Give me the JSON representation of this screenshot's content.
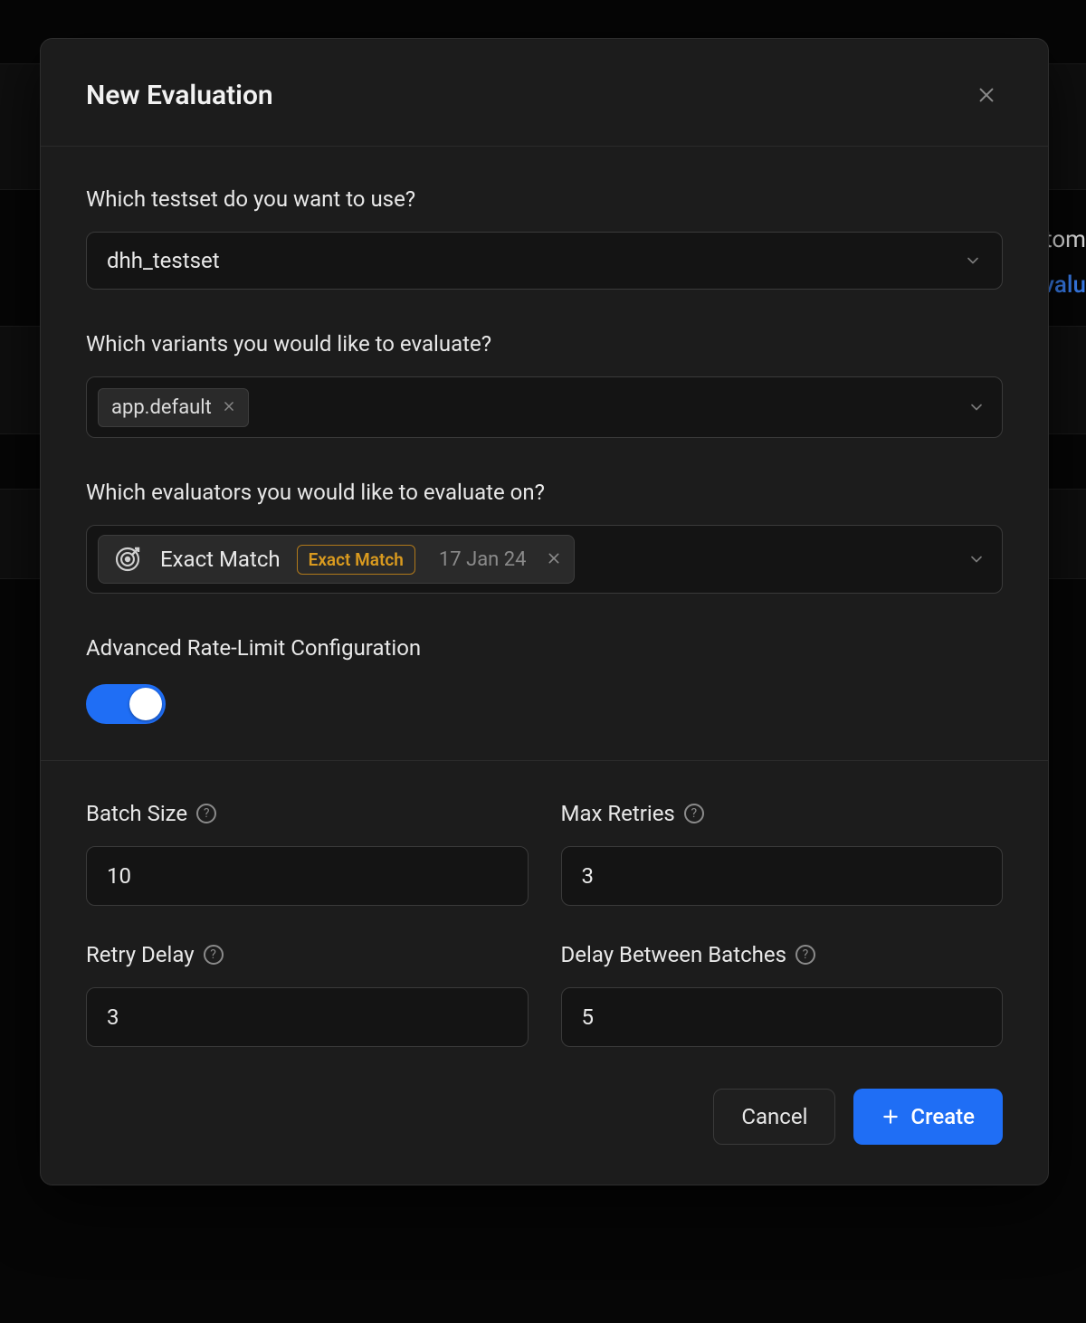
{
  "background": {
    "tab_fragment": "stom",
    "link_fragment": "Evalu"
  },
  "modal": {
    "title": "New Evaluation",
    "testset": {
      "label": "Which testset do you want to use?",
      "value": "dhh_testset"
    },
    "variants": {
      "label": "Which variants you would like to evaluate?",
      "tags": [
        {
          "label": "app.default"
        }
      ]
    },
    "evaluators": {
      "label": "Which evaluators you would like to evaluate on?",
      "items": [
        {
          "name": "Exact Match",
          "badge": "Exact Match",
          "date": "17 Jan 24"
        }
      ]
    },
    "rate_limit": {
      "label": "Advanced Rate-Limit Configuration",
      "enabled": true
    },
    "config": {
      "batch_size": {
        "label": "Batch Size",
        "value": "10"
      },
      "max_retries": {
        "label": "Max Retries",
        "value": "3"
      },
      "retry_delay": {
        "label": "Retry Delay",
        "value": "3"
      },
      "delay_between_batches": {
        "label": "Delay Between Batches",
        "value": "5"
      }
    },
    "buttons": {
      "cancel": "Cancel",
      "create": "Create"
    }
  }
}
